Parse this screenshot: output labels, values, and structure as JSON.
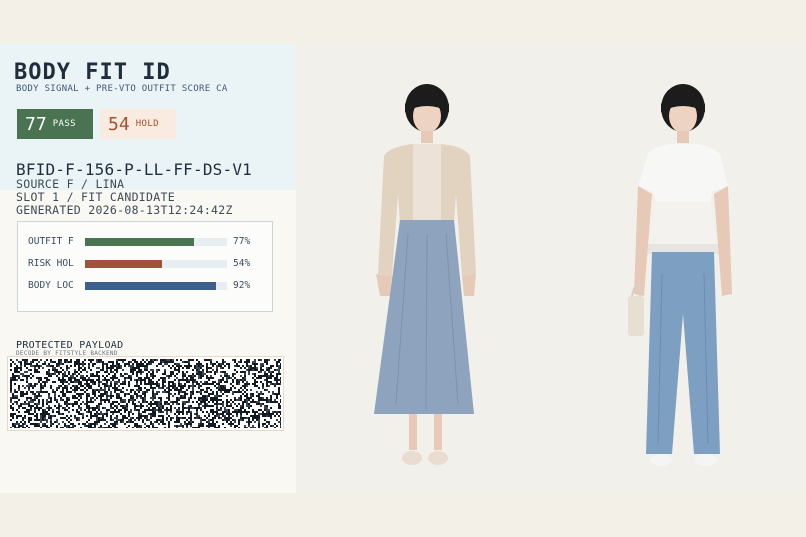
{
  "header": {
    "title": "BODY FIT ID",
    "subtitle": "BODY SIGNAL + PRE-VTO OUTFIT SCORE CA"
  },
  "badges": [
    {
      "value": "77",
      "label": "PASS",
      "color": "#4a7352"
    },
    {
      "value": "54",
      "label": "HOLD",
      "color": "#a85030"
    }
  ],
  "meta": {
    "id": "BFID-F-156-P-LL-FF-DS-V1",
    "source": "SOURCE F / LINA",
    "slot": "SLOT 1 / FIT CANDIDATE",
    "generated": "GENERATED 2026-08-13T12:24:42Z"
  },
  "scores": [
    {
      "label": "OUTFIT F",
      "value": 77,
      "display": "77%",
      "color": "#4a7352"
    },
    {
      "label": "RISK HOL",
      "value": 54,
      "display": "54%",
      "color": "#a0523a"
    },
    {
      "label": "BODY LOC",
      "value": 92,
      "display": "92%",
      "color": "#3d5f8c"
    }
  ],
  "payload": {
    "title": "PROTECTED PAYLOAD",
    "subtitle": "DECODE BY FITSTYLE BACKEND"
  }
}
